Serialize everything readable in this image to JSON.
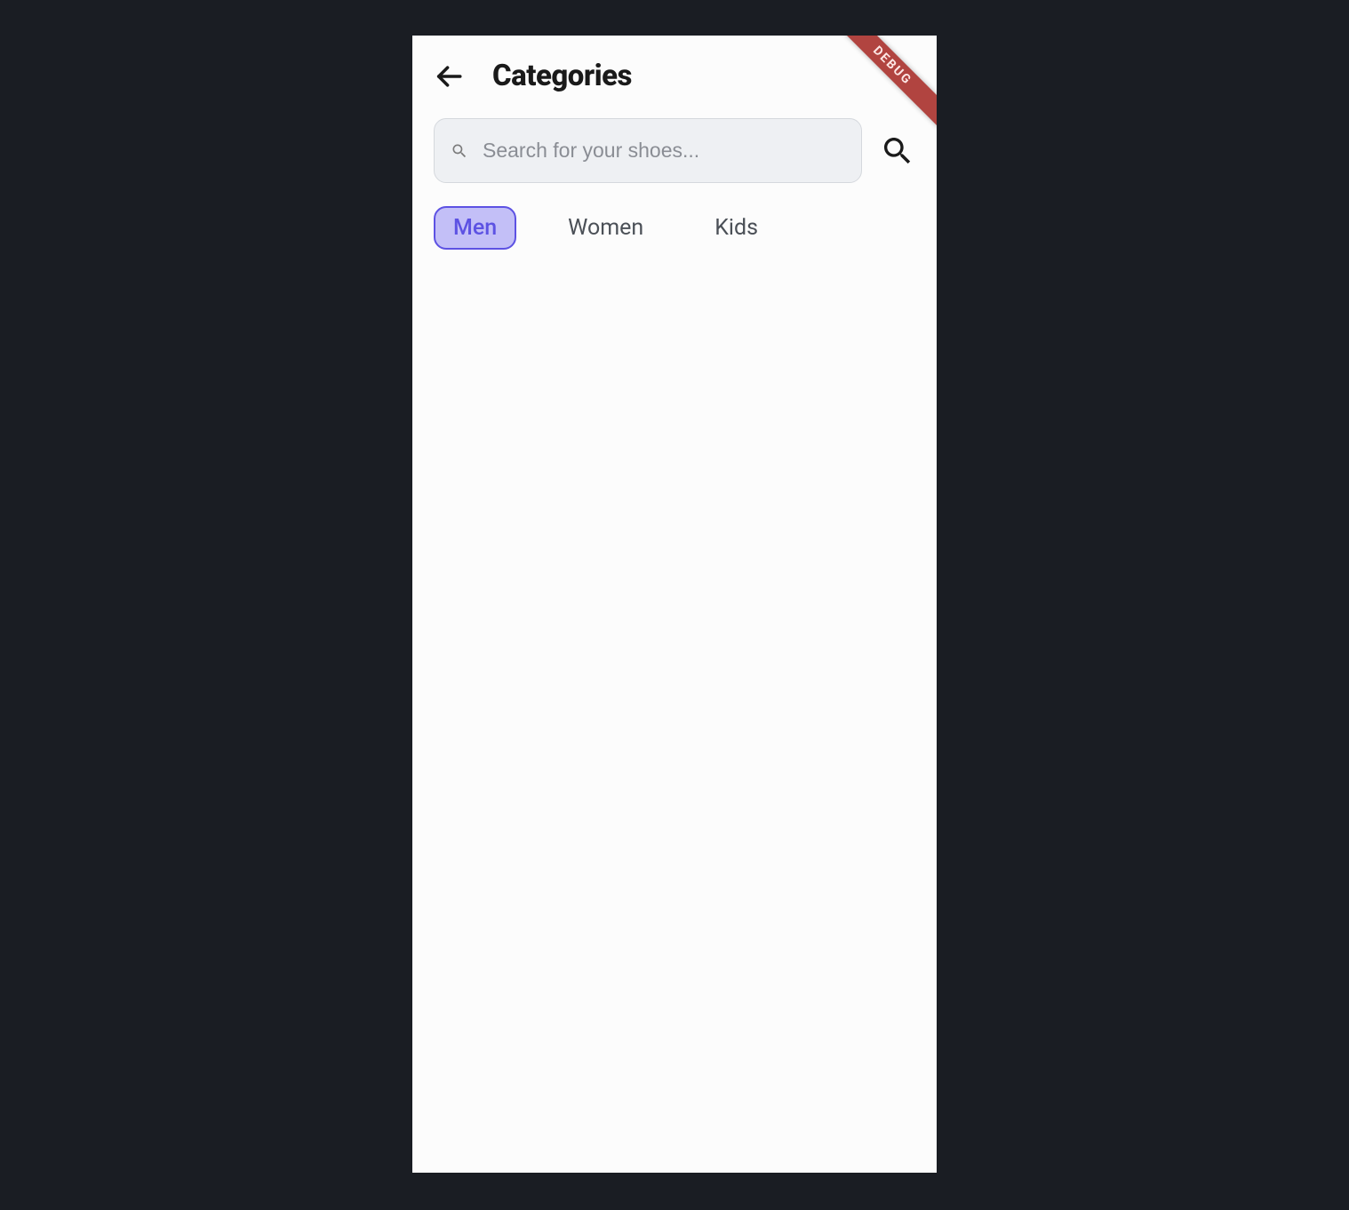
{
  "header": {
    "title": "Categories"
  },
  "search": {
    "placeholder": "Search for your shoes..."
  },
  "tabs": [
    {
      "label": "Men",
      "active": true
    },
    {
      "label": "Women",
      "active": false
    },
    {
      "label": "Kids",
      "active": false
    }
  ],
  "debug_label": "DEBUG"
}
